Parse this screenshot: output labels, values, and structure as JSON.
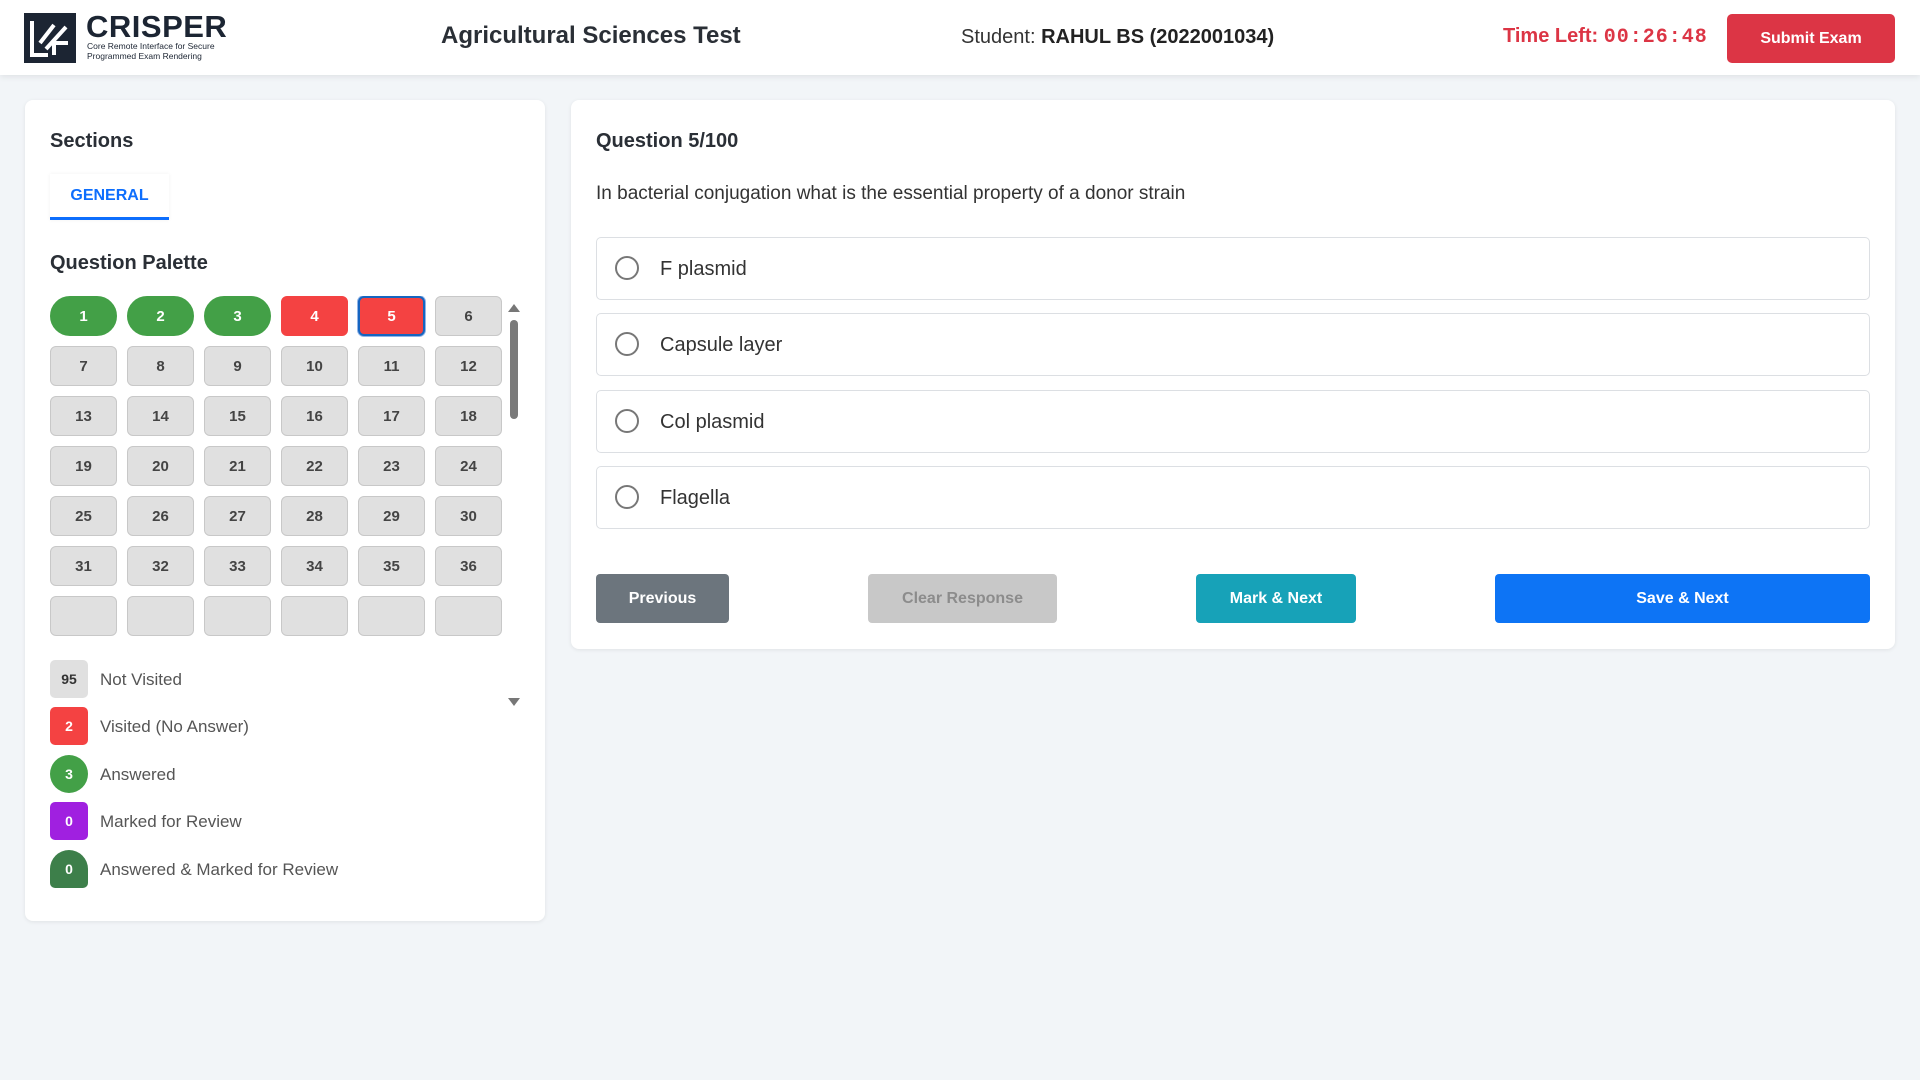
{
  "header": {
    "logo_title": "CRISPER",
    "logo_subtitle": "Core Remote Interface for Secure Programmed Exam Rendering",
    "test_title": "Agricultural Sciences Test",
    "student_label": "Student:",
    "student_name": "RAHUL BS (2022001034)",
    "time_label": "Time Left:",
    "time_value": "00:26:48",
    "submit_label": "Submit Exam"
  },
  "sidebar": {
    "sections_title": "Sections",
    "tab_label": "GENERAL",
    "palette_title": "Question Palette",
    "questions": [
      {
        "n": "1",
        "status": "answered"
      },
      {
        "n": "2",
        "status": "answered"
      },
      {
        "n": "3",
        "status": "answered"
      },
      {
        "n": "4",
        "status": "visited"
      },
      {
        "n": "5",
        "status": "current"
      },
      {
        "n": "6",
        "status": "not-visited"
      },
      {
        "n": "7",
        "status": "not-visited"
      },
      {
        "n": "8",
        "status": "not-visited"
      },
      {
        "n": "9",
        "status": "not-visited"
      },
      {
        "n": "10",
        "status": "not-visited"
      },
      {
        "n": "11",
        "status": "not-visited"
      },
      {
        "n": "12",
        "status": "not-visited"
      },
      {
        "n": "13",
        "status": "not-visited"
      },
      {
        "n": "14",
        "status": "not-visited"
      },
      {
        "n": "15",
        "status": "not-visited"
      },
      {
        "n": "16",
        "status": "not-visited"
      },
      {
        "n": "17",
        "status": "not-visited"
      },
      {
        "n": "18",
        "status": "not-visited"
      },
      {
        "n": "19",
        "status": "not-visited"
      },
      {
        "n": "20",
        "status": "not-visited"
      },
      {
        "n": "21",
        "status": "not-visited"
      },
      {
        "n": "22",
        "status": "not-visited"
      },
      {
        "n": "23",
        "status": "not-visited"
      },
      {
        "n": "24",
        "status": "not-visited"
      },
      {
        "n": "25",
        "status": "not-visited"
      },
      {
        "n": "26",
        "status": "not-visited"
      },
      {
        "n": "27",
        "status": "not-visited"
      },
      {
        "n": "28",
        "status": "not-visited"
      },
      {
        "n": "29",
        "status": "not-visited"
      },
      {
        "n": "30",
        "status": "not-visited"
      },
      {
        "n": "31",
        "status": "not-visited"
      },
      {
        "n": "32",
        "status": "not-visited"
      },
      {
        "n": "33",
        "status": "not-visited"
      },
      {
        "n": "34",
        "status": "not-visited"
      },
      {
        "n": "35",
        "status": "not-visited"
      },
      {
        "n": "36",
        "status": "not-visited"
      },
      {
        "n": "",
        "status": "not-visited"
      },
      {
        "n": "",
        "status": "not-visited"
      },
      {
        "n": "",
        "status": "not-visited"
      },
      {
        "n": "",
        "status": "not-visited"
      },
      {
        "n": "",
        "status": "not-visited"
      },
      {
        "n": "",
        "status": "not-visited"
      }
    ],
    "legend": [
      {
        "count": "95",
        "label": "Not Visited",
        "kind": "notvisited"
      },
      {
        "count": "2",
        "label": "Visited (No Answer)",
        "kind": "visited"
      },
      {
        "count": "3",
        "label": "Answered",
        "kind": "answered"
      },
      {
        "count": "0",
        "label": "Marked for Review",
        "kind": "marked"
      },
      {
        "count": "0",
        "label": "Answered & Marked for Review",
        "kind": "ansmarked"
      }
    ]
  },
  "main": {
    "question_number": "Question 5/100",
    "question_text": "In bacterial conjugation what is the essential property of a donor strain",
    "options": [
      {
        "label": "F plasmid"
      },
      {
        "label": "Capsule layer"
      },
      {
        "label": "Col plasmid"
      },
      {
        "label": "Flagella"
      }
    ],
    "previous_label": "Previous",
    "clear_label": "Clear Response",
    "mark_label": "Mark & Next",
    "save_label": "Save & Next"
  },
  "colors": {
    "answered": "#43a047",
    "visited": "#f44242",
    "marked": "#a020e0",
    "answered_marked": "#3d7f4a",
    "not_visited": "#e0e0e0",
    "primary": "#0d74f5",
    "danger": "#dc3545",
    "info": "#17a2b8"
  }
}
